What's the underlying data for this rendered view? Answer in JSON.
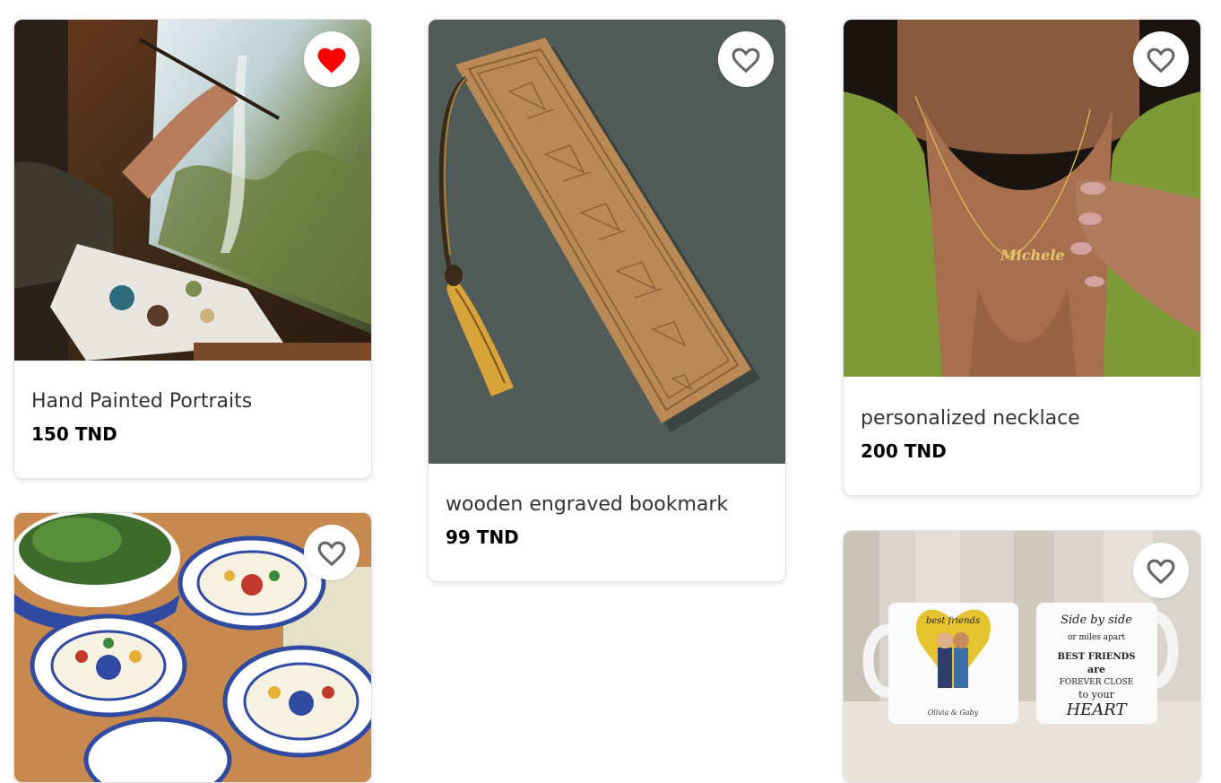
{
  "products": [
    {
      "name": "Hand Painted Portraits",
      "price": "150 TND",
      "favorited": true,
      "image": "painter-at-easel"
    },
    {
      "name": "wooden engraved bookmark",
      "price": "99 TND",
      "favorited": false,
      "image": "wooden-bookmark"
    },
    {
      "name": "personalized necklace",
      "price": "200 TND",
      "favorited": false,
      "image": "name-necklace"
    },
    {
      "name": "",
      "price": "",
      "favorited": false,
      "image": "ceramic-bowls"
    },
    {
      "name": "",
      "price": "",
      "favorited": false,
      "image": "friendship-mugs"
    }
  ],
  "mug_text": {
    "left_script": "best friends",
    "left_names": "Olivia & Gaby",
    "right_line1": "Side by side",
    "right_line2": "or miles apart",
    "right_line3": "BEST FRIENDS",
    "right_line4": "are",
    "right_line5": "FOREVER CLOSE",
    "right_line6": "to your",
    "right_line7": "HEART"
  },
  "necklace_text": "Michele",
  "colors": {
    "heart_active": "#ff0000",
    "heart_outline": "#666666"
  }
}
